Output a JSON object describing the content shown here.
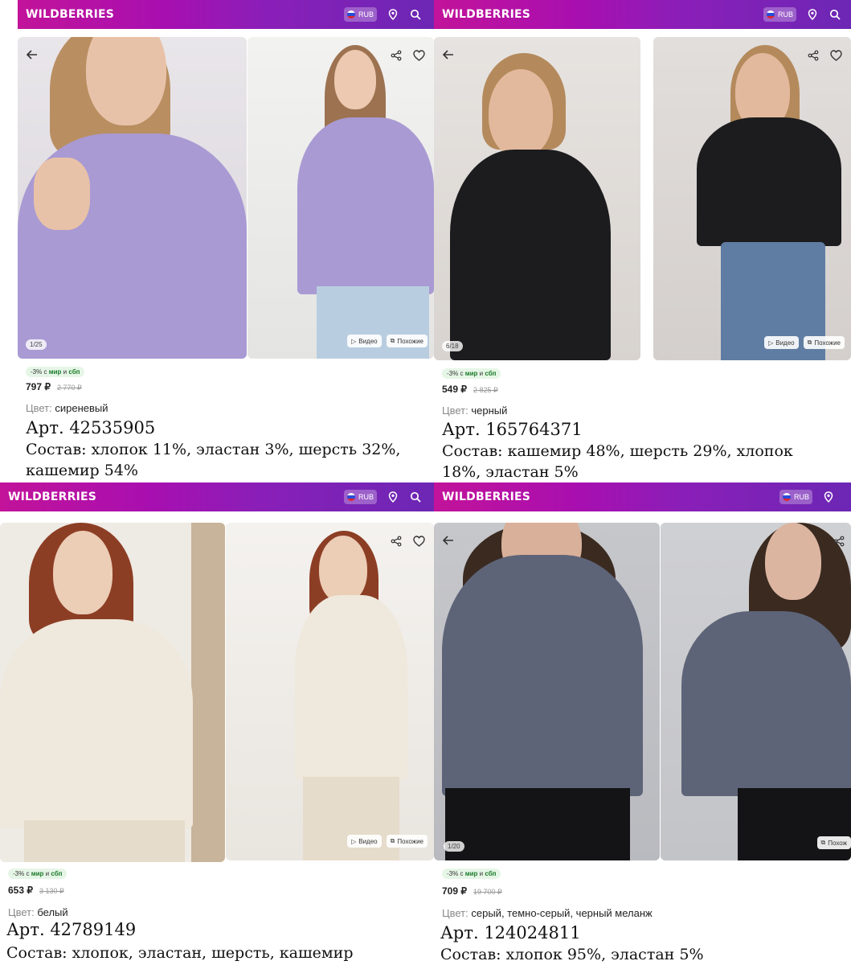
{
  "app": {
    "logo": "WILDBERRIES",
    "currency": "RUB"
  },
  "products": [
    {
      "counter": "1/25",
      "promo_prefix": "-3% с",
      "promo_mir": "мир",
      "promo_and": "и",
      "promo_sbp": "сбп",
      "price": "797 ₽",
      "old_price": "2 770 ₽",
      "color_label": "Цвет:",
      "color_value": "сиреневый",
      "article": "Арт. 42535905",
      "composition": "Состав: хлопок 11%, эластан 3%, шерсть 32%, кашемир 54%",
      "pill_video": "Видео",
      "pill_similar": "Похожие",
      "garment_color": "#a99ad3"
    },
    {
      "counter": "6/18",
      "promo_prefix": "-3% с",
      "promo_mir": "мир",
      "promo_and": "и",
      "promo_sbp": "сбп",
      "price": "549 ₽",
      "old_price": "2 825 ₽",
      "color_label": "Цвет:",
      "color_value": "черный",
      "article": "Арт. 165764371",
      "composition": "Состав: кашемир 48%, шерсть 29%, хлопок 18%, эластан 5%",
      "pill_video": "Видео",
      "pill_similar": "Похожие",
      "garment_color": "#1c1c1e"
    },
    {
      "counter": "",
      "promo_prefix": "-3% с",
      "promo_mir": "мир",
      "promo_and": "и",
      "promo_sbp": "сбп",
      "price": "653 ₽",
      "old_price": "3 130 ₽",
      "color_label": "Цвет:",
      "color_value": "белый",
      "article": "Арт. 42789149",
      "composition": "Состав: хлопок, эластан, шерсть, кашемир",
      "pill_video": "Видео",
      "pill_similar": "Похожие",
      "garment_color": "#efe8dc"
    },
    {
      "counter": "1/20",
      "promo_prefix": "-3% с",
      "promo_mir": "мир",
      "promo_and": "и",
      "promo_sbp": "сбп",
      "price": "709 ₽",
      "old_price": "19 700 ₽",
      "color_label": "Цвет:",
      "color_value": "серый, темно-серый, черный меланж",
      "article": "Арт. 124024811",
      "composition": "Состав: хлопок 95%, эластан 5%",
      "pill_video": "",
      "pill_similar": "Похож",
      "garment_color": "#5e6478"
    }
  ]
}
